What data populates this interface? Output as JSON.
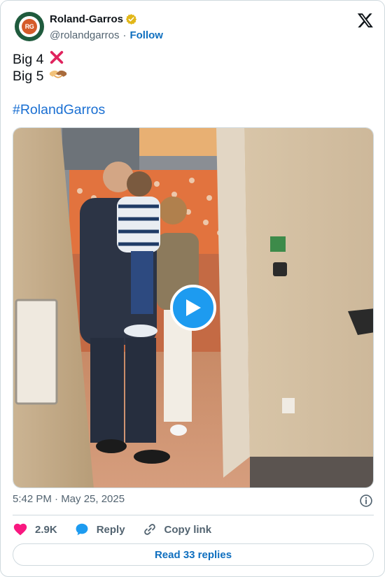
{
  "account": {
    "display_name": "Roland-Garros",
    "handle": "@rolandgarros",
    "separator": "·",
    "follow_label": "Follow",
    "avatar_text": "RG",
    "verified_color": "#e2b719"
  },
  "tweet": {
    "line1_text": "Big 4",
    "line1_emoji": "❌",
    "line2_text": "Big 5",
    "line2_emoji": "🫱🏼‍🫲🏾",
    "hashtag": "#RolandGarros"
  },
  "media": {
    "type": "video",
    "play_icon": "play-icon"
  },
  "meta": {
    "timestamp": "5:42 PM · May 25, 2025"
  },
  "actions": {
    "like_count": "2.9K",
    "reply_label": "Reply",
    "copy_link_label": "Copy link"
  },
  "footer": {
    "read_replies_label": "Read 33 replies"
  },
  "colors": {
    "link": "#1a6fd2",
    "like": "#f91880",
    "play_button": "#1d9bf0",
    "border": "#cfd9de"
  }
}
